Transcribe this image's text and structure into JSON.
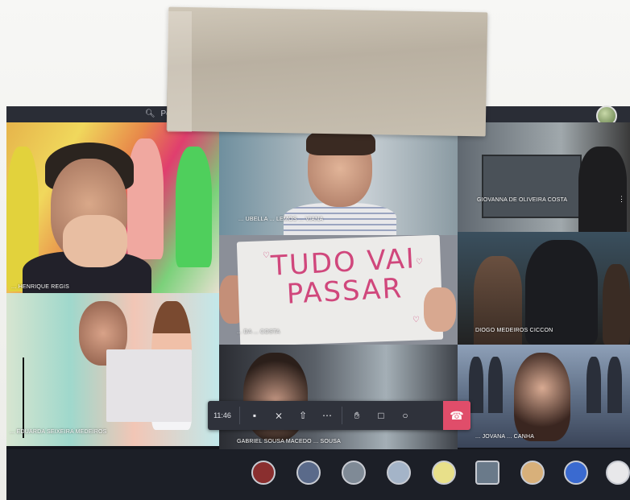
{
  "meeting": {
    "search_label": "Pesqu",
    "clock": "11:46"
  },
  "participants": [
    {
      "name": "... HENRIQUE REGIS"
    },
    {
      "name": "... UBELLA ... LEMOS ... VIANA"
    },
    {
      "name": "GIOVANNA DE OLIVEIRA COSTA"
    },
    {
      "name": "... DA ... COSTA"
    },
    {
      "name": "DIOGO MEDEIROS CICCON"
    },
    {
      "name": "... EDUARDA SEIXEIRA MEDEIROS"
    },
    {
      "name": "GABRIEL SOUSA MACEDO ... SOUSA"
    },
    {
      "name": "... JOVANA ... CANHA"
    }
  ],
  "sign": {
    "line1": "TUDO VAI",
    "line2": "PASSAR"
  },
  "controls": [
    {
      "icon": "camera-icon"
    },
    {
      "icon": "mic-off-icon"
    },
    {
      "icon": "share-screen-icon"
    },
    {
      "icon": "more-icon"
    },
    {
      "icon": "raise-hand-icon"
    },
    {
      "icon": "chat-icon"
    },
    {
      "icon": "participants-icon"
    },
    {
      "icon": "hang-up-icon"
    }
  ],
  "colors": {
    "hangup": "#e04d6a",
    "sign_ink": "#d0477c",
    "titlebar": "#2a2d36"
  }
}
